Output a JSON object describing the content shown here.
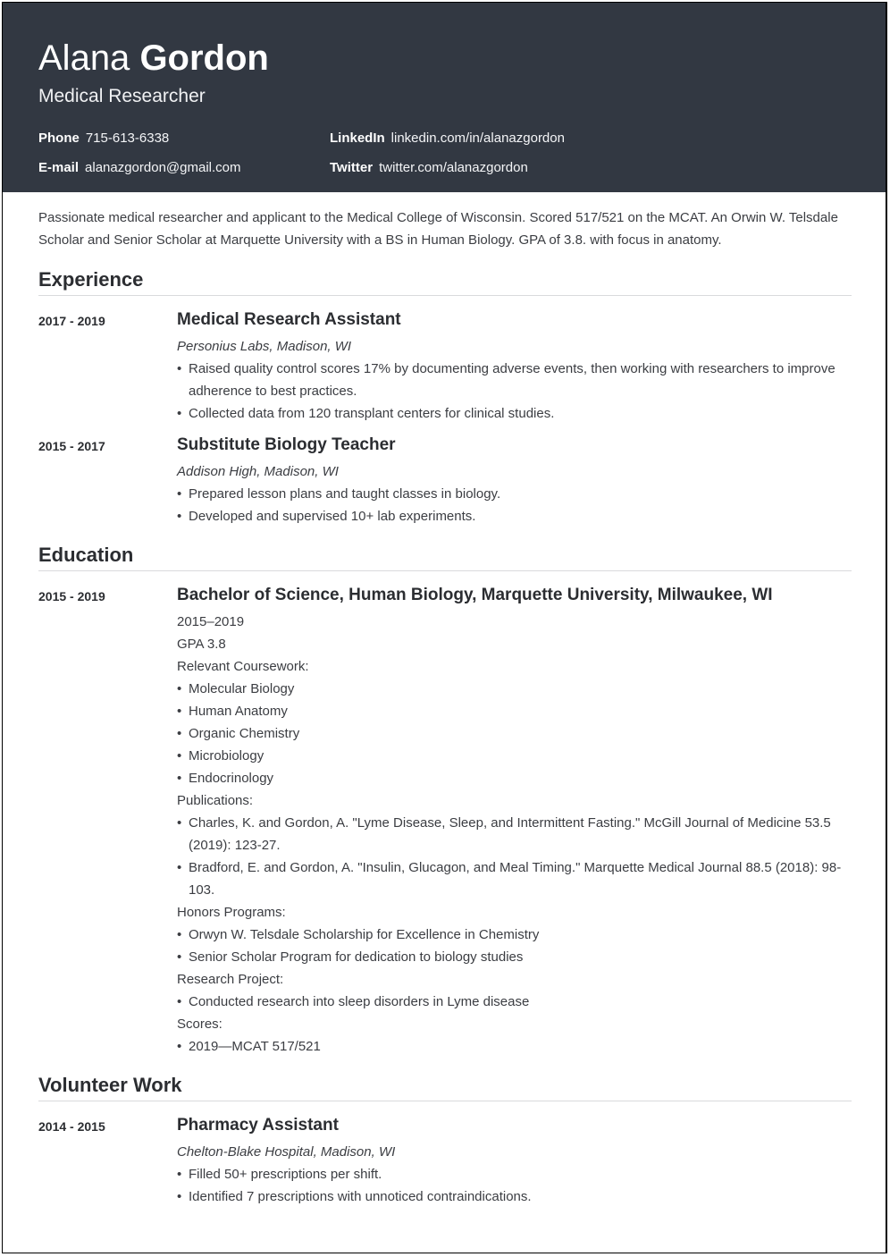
{
  "header": {
    "first_name": "Alana",
    "last_name": "Gordon",
    "role": "Medical Researcher",
    "contacts": {
      "phone": {
        "label": "Phone",
        "value": "715-613-6338"
      },
      "email": {
        "label": "E-mail",
        "value": "alanazgordon@gmail.com"
      },
      "linkedin": {
        "label": "LinkedIn",
        "value": "linkedin.com/in/alanazgordon"
      },
      "twitter": {
        "label": "Twitter",
        "value": "twitter.com/alanazgordon"
      }
    }
  },
  "summary": "Passionate medical researcher and applicant to the Medical College of Wisconsin. Scored 517/521 on the MCAT. An Orwin W. Telsdale Scholar and Senior Scholar at Marquette University with a BS in Human Biology. GPA of 3.8. with focus in anatomy.",
  "experience": {
    "title": "Experience",
    "items": [
      {
        "dates": "2017 - 2019",
        "title": "Medical Research Assistant",
        "org": "Personius Labs, Madison, WI",
        "bullets": [
          "Raised quality control scores 17% by documenting adverse events, then working with researchers to improve adherence to best practices.",
          "Collected data from 120 transplant centers for clinical studies."
        ]
      },
      {
        "dates": "2015 - 2017",
        "title": "Substitute Biology Teacher",
        "org": "Addison High, Madison, WI",
        "bullets": [
          "Prepared lesson plans and taught classes in biology.",
          "Developed and supervised 10+ lab experiments."
        ]
      }
    ]
  },
  "education": {
    "title": "Education",
    "item": {
      "dates": "2015 - 2019",
      "title": "Bachelor of Science, Human Biology, Marquette University, Milwaukee, WI",
      "years": "2015–2019",
      "gpa": "GPA 3.8",
      "coursework_label": "Relevant Coursework:",
      "coursework": [
        "Molecular Biology",
        "Human Anatomy",
        "Organic Chemistry",
        "Microbiology",
        "Endocrinology"
      ],
      "publications_label": "Publications:",
      "publications": [
        "Charles, K. and Gordon, A. \"Lyme Disease, Sleep, and Intermittent Fasting.\" McGill Journal of Medicine 53.5 (2019): 123-27.",
        "Bradford, E. and Gordon, A. \"Insulin, Glucagon, and Meal Timing.\" Marquette Medical Journal 88.5 (2018): 98-103."
      ],
      "honors_label": "Honors Programs:",
      "honors": [
        "Orwyn W. Telsdale Scholarship for Excellence in Chemistry",
        "Senior Scholar Program for dedication to biology studies"
      ],
      "research_label": "Research Project:",
      "research": [
        "Conducted research into sleep disorders in Lyme disease"
      ],
      "scores_label": "Scores:",
      "scores": [
        "2019—MCAT 517/521"
      ]
    }
  },
  "volunteer": {
    "title": "Volunteer Work",
    "item": {
      "dates": "2014 - 2015",
      "title": "Pharmacy Assistant",
      "org": "Chelton-Blake Hospital, Madison, WI",
      "bullets": [
        "Filled 50+ prescriptions per shift.",
        "Identified 7 prescriptions with unnoticed contraindications."
      ]
    }
  },
  "colors": {
    "header_bg": "#323842",
    "text": "#3b3d42",
    "rule": "#d9dadc"
  }
}
